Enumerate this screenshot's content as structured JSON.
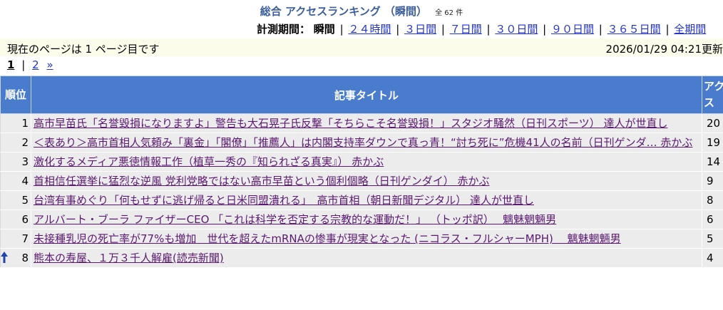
{
  "header": {
    "title": "総合 アクセスランキング （瞬間）",
    "count": "全 62 件"
  },
  "period": {
    "label": "計測期間：",
    "current": "瞬間",
    "links": [
      "２４時間",
      "３日間",
      "７日間",
      "３０日間",
      "９０日間",
      "３６５日間",
      "全期間"
    ]
  },
  "info": {
    "current_page_text": "現在のページは 1 ページ目です",
    "updated": "2026/01/29 04:21更新"
  },
  "pager": {
    "current": "1",
    "next_page": "2",
    "next": "»"
  },
  "table": {
    "headers": {
      "rank": "順位",
      "title": "記事タイトル",
      "access": "アクセス"
    },
    "rows": [
      {
        "rank": "1",
        "title": "高市早苗氏「名誉毀損になりますよ」警告も大石晃子氏反撃「そちらこそ名誉毀損！」スタジオ騒然（日刊スポーツ） 達人が世直し",
        "access": "20"
      },
      {
        "rank": "2",
        "title": "＜表あり＞高市首相人気頼み「裏金」「閣僚」「推薦人」は内閣支持率ダウンで真っ青！“討ち死に”危機41人の名前（日刊ゲンダ… 赤かぶ",
        "access": "19"
      },
      {
        "rank": "3",
        "title": "激化するメディア悪徳情報工作（植草一秀の『知られざる真実』） 赤かぶ",
        "access": "14"
      },
      {
        "rank": "4",
        "title": "首相信任選挙に猛烈な逆風 党利党略ではない高市早苗という個利個略（日刊ゲンダイ） 赤かぶ",
        "access": "9"
      },
      {
        "rank": "5",
        "title": "台湾有事めぐり「何もせずに逃げ帰ると日米同盟潰れる」　高市首相（朝日新聞デジタル） 達人が世直し",
        "access": "8"
      },
      {
        "rank": "6",
        "title": "アルバート・ブーラ ファイザーCEO 「これは科学を否定する宗教的な運動だ！」 （トッポ訳）　 魑魅魍魎男",
        "access": "6"
      },
      {
        "rank": "7",
        "title": "未接種乳児の死亡率が77%も増加　世代を超えたmRNAの惨事が現実となった (ニコラス・フルシャーMPH)　 魑魅魍魎男",
        "access": "5"
      },
      {
        "rank": "8",
        "title": "熊本の寿屋、１万３千人解雇(読売新聞)",
        "access": "4",
        "trend": "up"
      }
    ]
  },
  "colors": {
    "header_bg": "#4a7ccd",
    "title_color": "#3b5e9c",
    "link_color": "#2233cc",
    "visited_link": "#5b1a72",
    "info_bg": "#fcfcea",
    "row_bg": "#ececec",
    "trend_up": "#2244aa"
  }
}
